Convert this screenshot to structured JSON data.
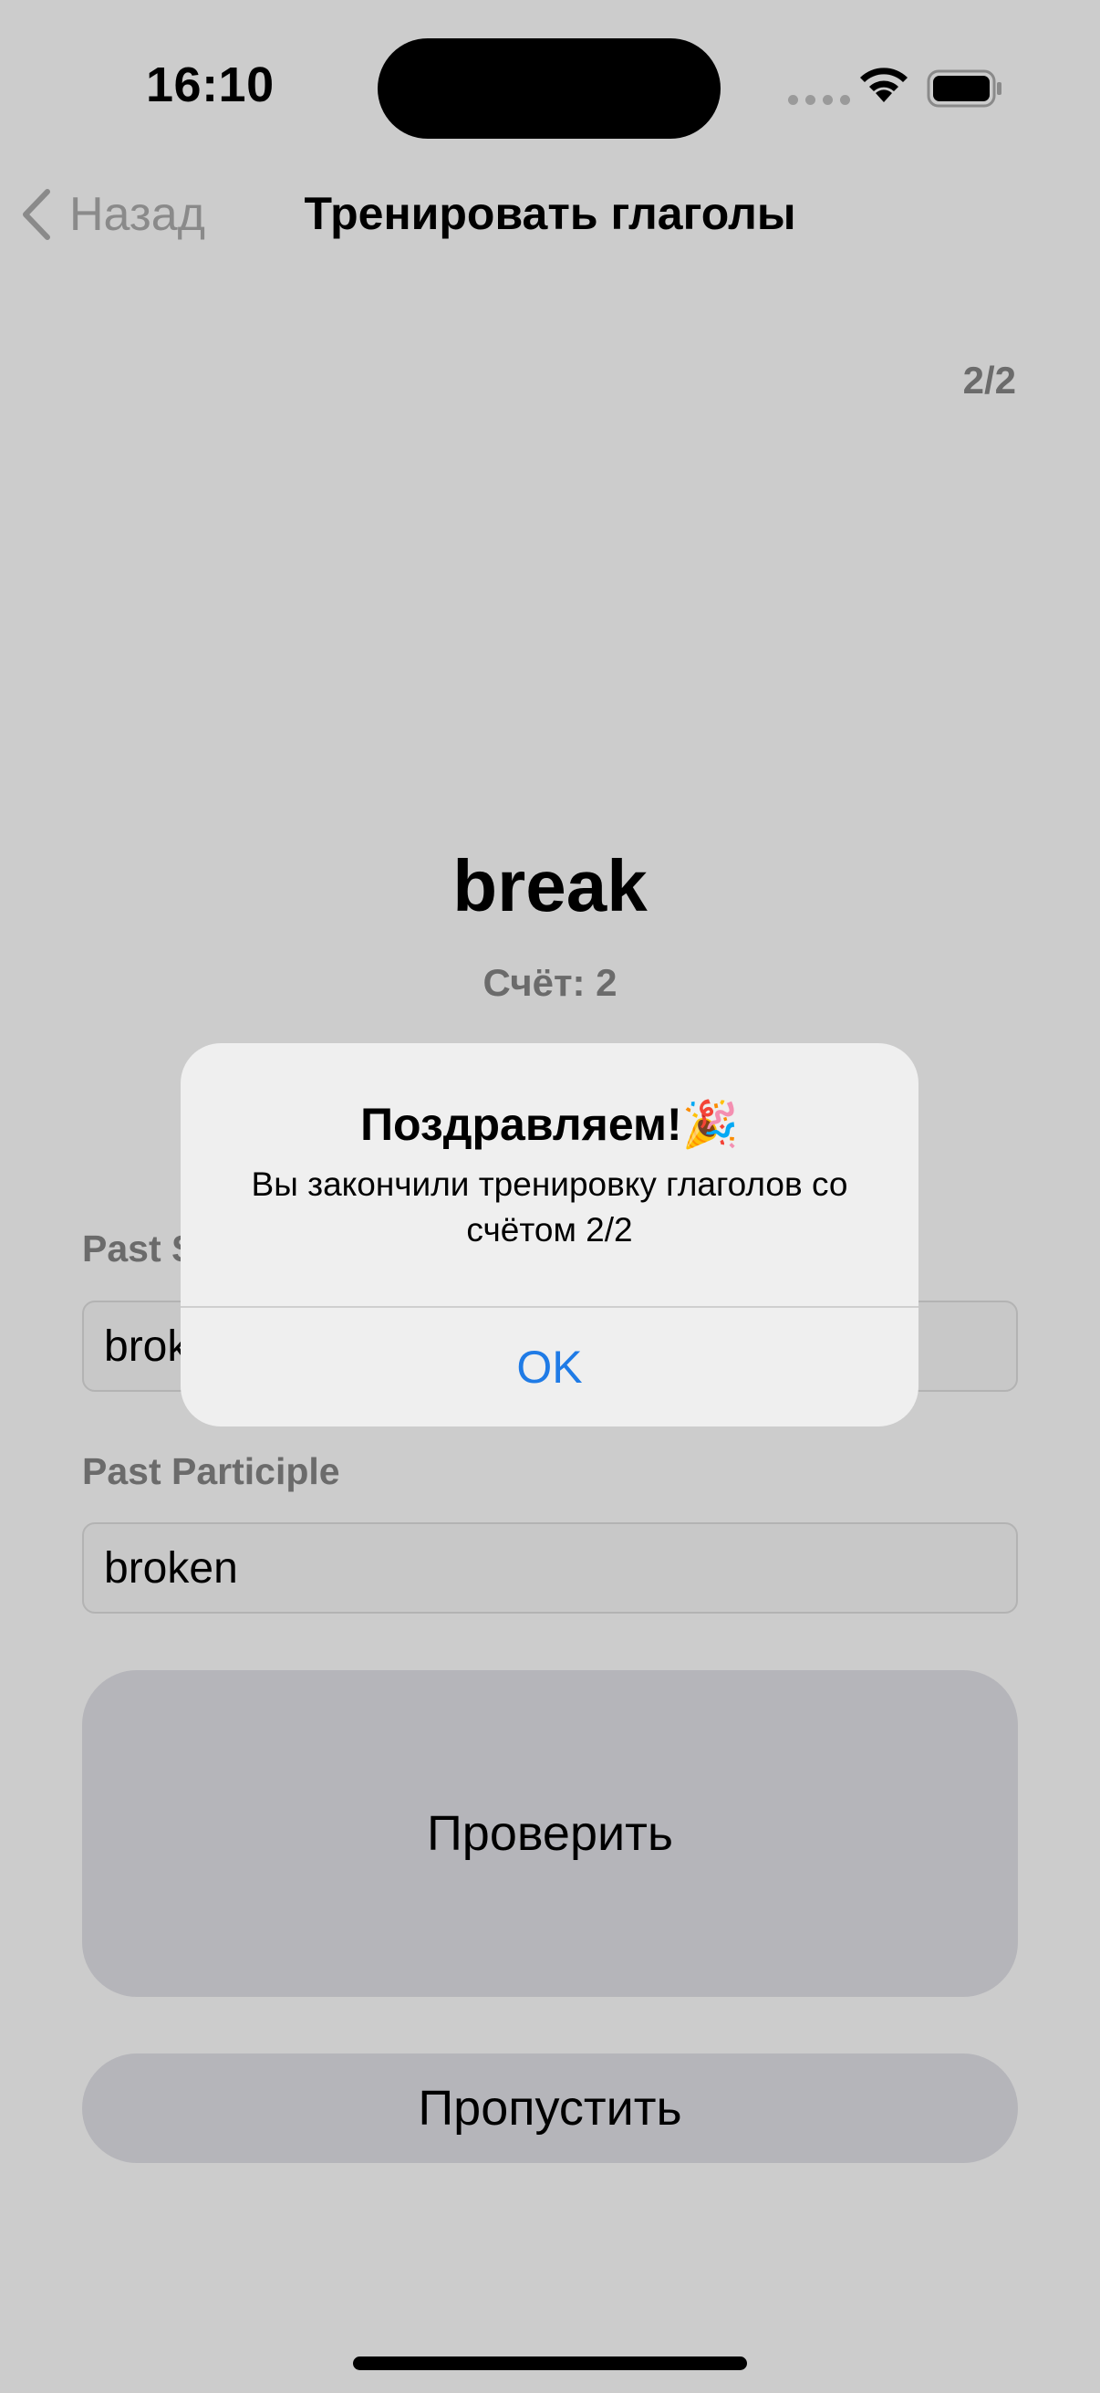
{
  "status_bar": {
    "time": "16:10"
  },
  "nav": {
    "back_label": "Назад",
    "title": "Тренировать глаголы"
  },
  "progress": "2/2",
  "verb": "break",
  "score": "Счёт: 2",
  "fields": {
    "past_simple": {
      "label": "Past Simple",
      "value": "broke"
    },
    "past_participle": {
      "label": "Past Participle",
      "value": "broken"
    }
  },
  "buttons": {
    "check": "Проверить",
    "skip": "Пропустить"
  },
  "alert": {
    "title": "Поздравляем!🎉",
    "message": "Вы закончили тренировку глаголов со счётом 2/2",
    "ok": "OK"
  },
  "colors": {
    "background": "#cccccc",
    "accent": "#1f7be6",
    "button": "#b5b5ba",
    "alert_bg": "#efefef"
  },
  "icons": {
    "back": "chevron-left-icon",
    "wifi": "wifi-icon",
    "battery": "battery-icon",
    "signal": "cellular-signal-icon"
  }
}
